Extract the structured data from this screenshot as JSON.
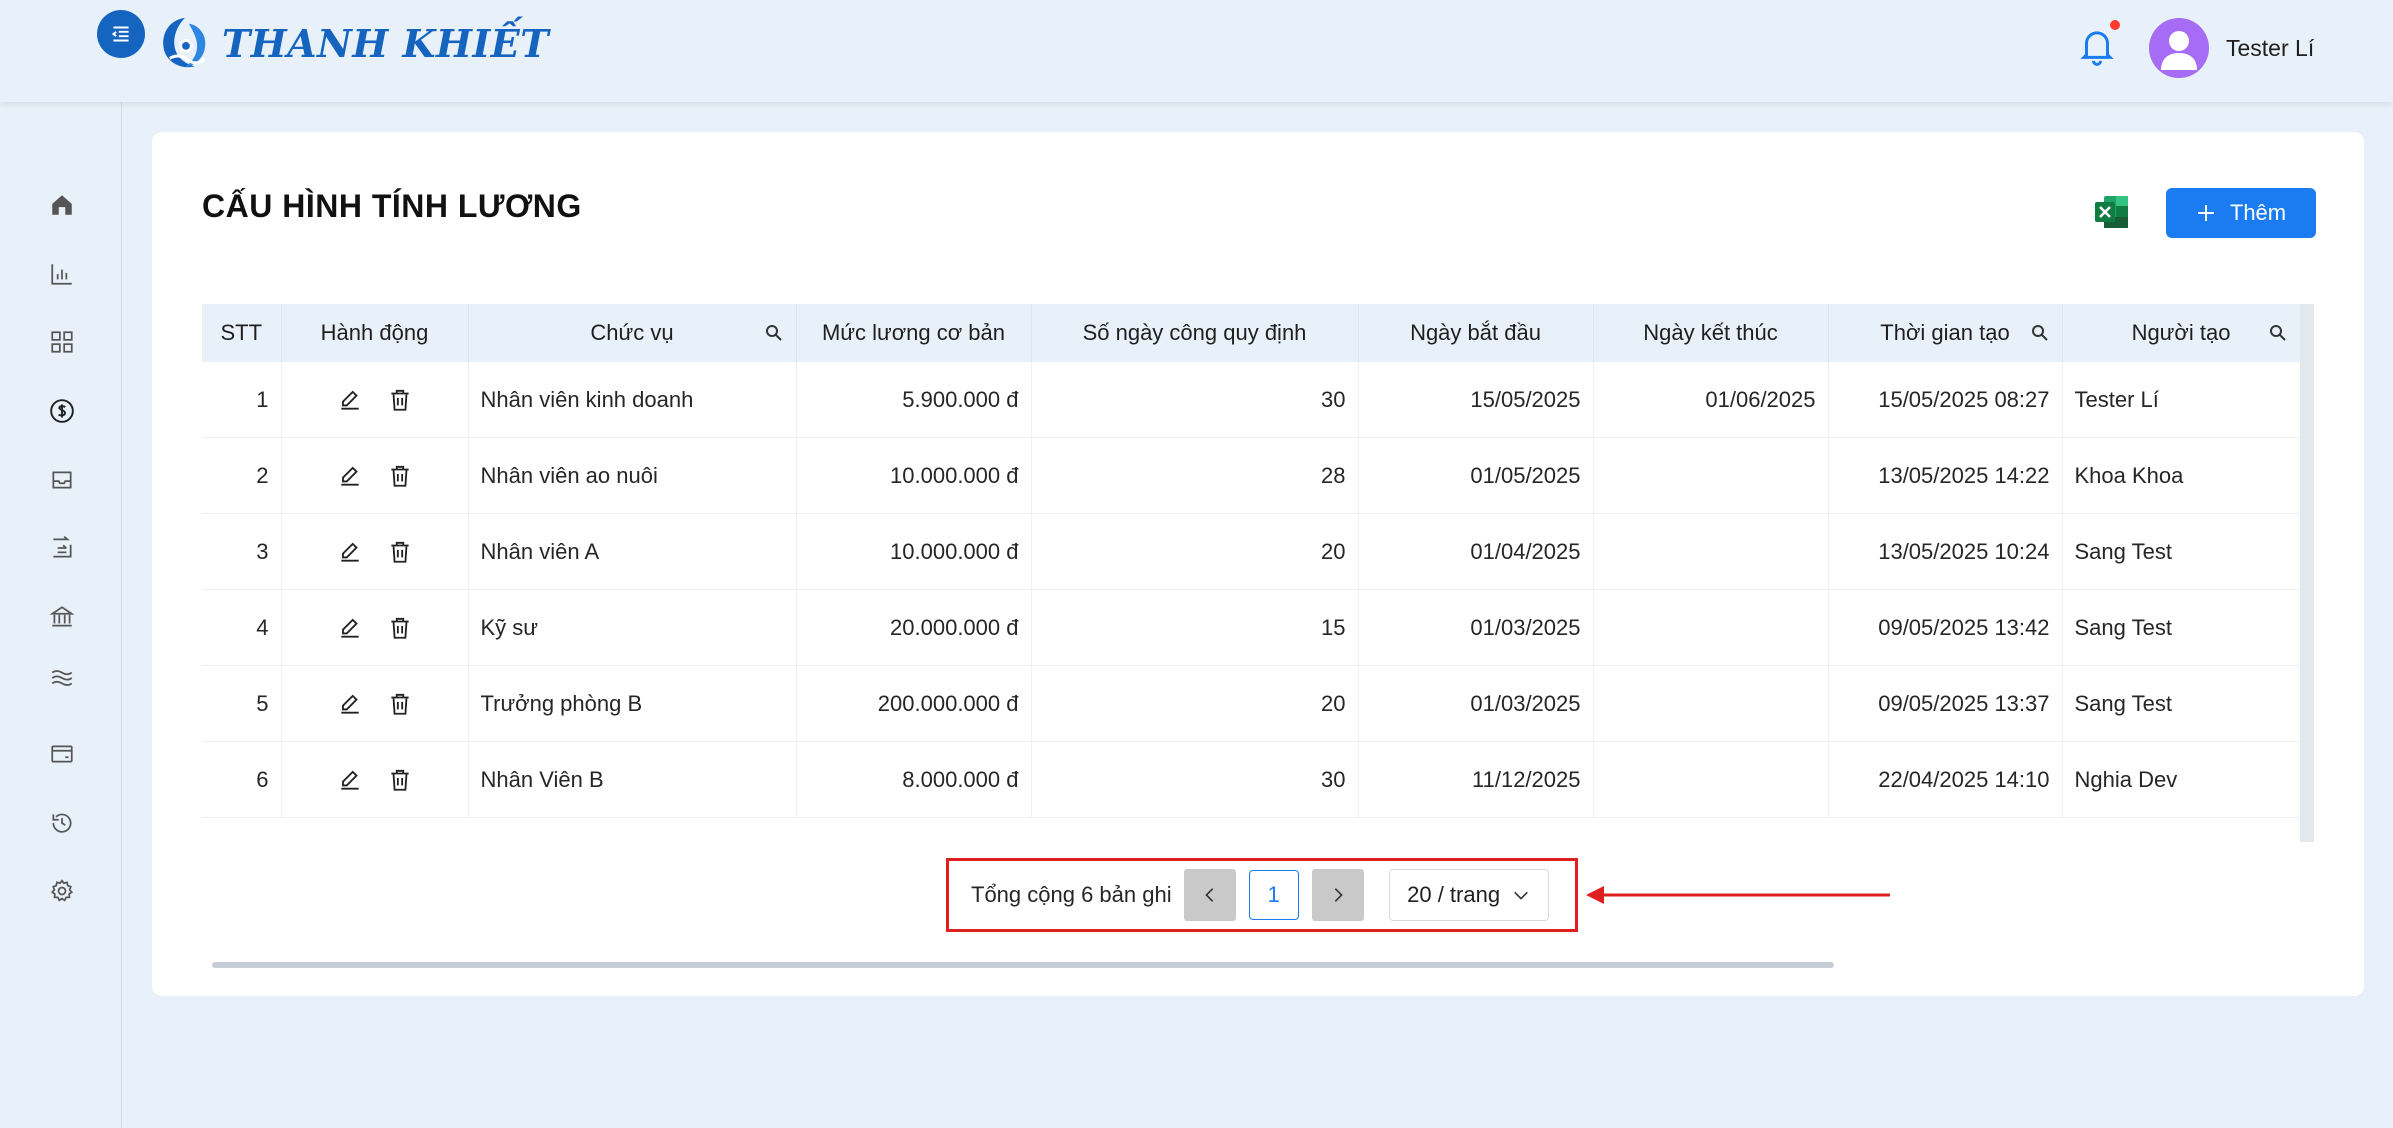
{
  "app": {
    "brand": "THANH KHIẾT"
  },
  "header": {
    "user_name": "Tester Lí"
  },
  "sidebar": {
    "icons": [
      "home-icon",
      "bar-chart-icon",
      "grid-icon",
      "dollar-icon",
      "inbox-icon",
      "transfer-icon",
      "bank-icon",
      "water-icon",
      "wallet-icon",
      "history-icon",
      "settings-icon"
    ]
  },
  "page": {
    "title": "CẤU HÌNH TÍNH LƯƠNG",
    "add_label": "Thêm"
  },
  "table": {
    "headers": {
      "stt": "STT",
      "actions": "Hành động",
      "position": "Chức vụ",
      "salary": "Mức lương cơ bản",
      "workdays": "Số ngày công quy định",
      "start": "Ngày bắt đầu",
      "end": "Ngày kết thúc",
      "created_time": "Thời gian tạo",
      "creator": "Người tạo"
    },
    "rows": [
      {
        "stt": "1",
        "position": "Nhân viên kinh doanh",
        "salary": "5.900.000 đ",
        "workdays": "30",
        "start": "15/05/2025",
        "end": "01/06/2025",
        "created_time": "15/05/2025 08:27",
        "creator": "Tester Lí"
      },
      {
        "stt": "2",
        "position": "Nhân viên ao nuôi",
        "salary": "10.000.000 đ",
        "workdays": "28",
        "start": "01/05/2025",
        "end": "",
        "created_time": "13/05/2025 14:22",
        "creator": "Khoa Khoa"
      },
      {
        "stt": "3",
        "position": "Nhân viên A",
        "salary": "10.000.000 đ",
        "workdays": "20",
        "start": "01/04/2025",
        "end": "",
        "created_time": "13/05/2025 10:24",
        "creator": "Sang Test"
      },
      {
        "stt": "4",
        "position": "Kỹ sư",
        "salary": "20.000.000 đ",
        "workdays": "15",
        "start": "01/03/2025",
        "end": "",
        "created_time": "09/05/2025 13:42",
        "creator": "Sang Test"
      },
      {
        "stt": "5",
        "position": "Trưởng phòng B",
        "salary": "200.000.000 đ",
        "workdays": "20",
        "start": "01/03/2025",
        "end": "",
        "created_time": "09/05/2025 13:37",
        "creator": "Sang Test"
      },
      {
        "stt": "6",
        "position": "Nhân Viên B",
        "salary": "8.000.000 đ",
        "workdays": "30",
        "start": "11/12/2025",
        "end": "",
        "created_time": "22/04/2025 14:10",
        "creator": "Nghia Dev"
      }
    ]
  },
  "pagination": {
    "total_text": "Tổng cộng 6 bản ghi",
    "current_page": "1",
    "page_size": "20 / trang"
  },
  "colors": {
    "primary": "#1a7cf0",
    "brand": "#1565c0",
    "highlight": "#e02020"
  }
}
